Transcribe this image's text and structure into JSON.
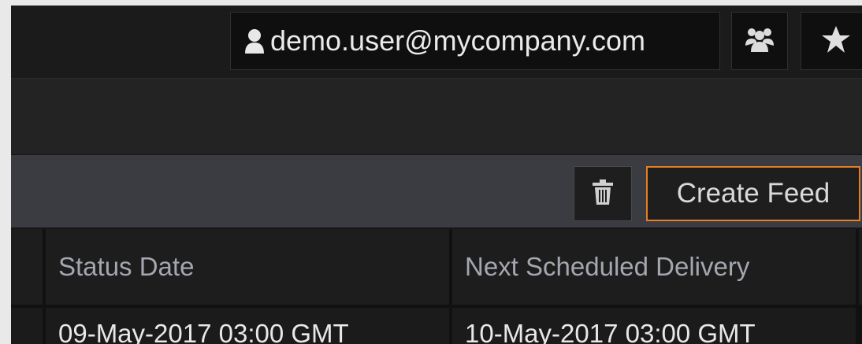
{
  "header": {
    "user_email": "demo.user@mycompany.com",
    "user_icon": "person-icon",
    "team_icon": "people-icon",
    "favorites_icon": "star-icon"
  },
  "toolbar": {
    "delete_icon": "trash-icon",
    "create_feed_label": "Create Feed",
    "accent_color": "#e67e22"
  },
  "table": {
    "columns": [
      "Status Date",
      "Next Scheduled Delivery"
    ],
    "rows": [
      [
        "09-May-2017 03:00 GMT",
        "10-May-2017 03:00 GMT"
      ]
    ]
  }
}
